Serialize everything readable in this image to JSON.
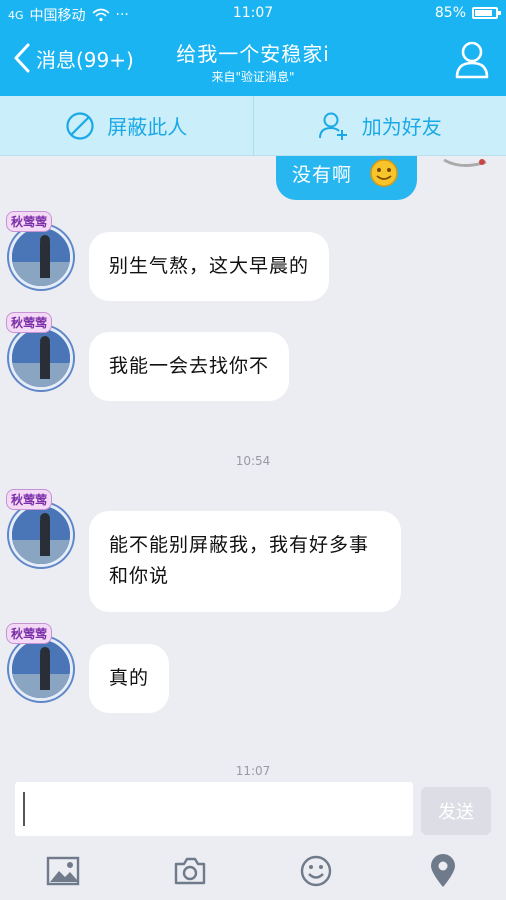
{
  "status_bar": {
    "signal": "4G",
    "carrier": "中国移动",
    "extra": "···",
    "time": "11:07",
    "battery_percent": "85%",
    "battery_level": 0.85
  },
  "header": {
    "back_label": "消息(99+)",
    "title": "给我一个安稳家i",
    "subtitle": "来自\"验证消息\""
  },
  "actions": {
    "block_label": "屏蔽此人",
    "add_friend_label": "加为好友"
  },
  "messages": [
    {
      "from": "me",
      "text": "没有啊"
    },
    {
      "from": "other",
      "avatar_tag": "秋莺莺",
      "text": "别生气熬，这大早晨的"
    },
    {
      "from": "other",
      "avatar_tag": "秋莺莺",
      "text": "我能一会去找你不"
    },
    {
      "from": "time",
      "text": "10:54"
    },
    {
      "from": "other",
      "avatar_tag": "秋莺莺",
      "text_line1": "能不能别屏蔽我，我有好多事",
      "text_line2": "和你说"
    },
    {
      "from": "other",
      "avatar_tag": "秋莺莺",
      "text": "真的"
    },
    {
      "from": "time",
      "text": "11:07"
    }
  ],
  "composer": {
    "send_label": "发送"
  },
  "colors": {
    "brand": "#1ab4f2",
    "action_bar": "#cbeefb",
    "background": "#ececf3"
  },
  "icons": [
    "back-chevron-icon",
    "profile-icon",
    "block-icon",
    "add-friend-icon",
    "image-icon",
    "camera-icon",
    "emoji-icon",
    "location-icon"
  ]
}
